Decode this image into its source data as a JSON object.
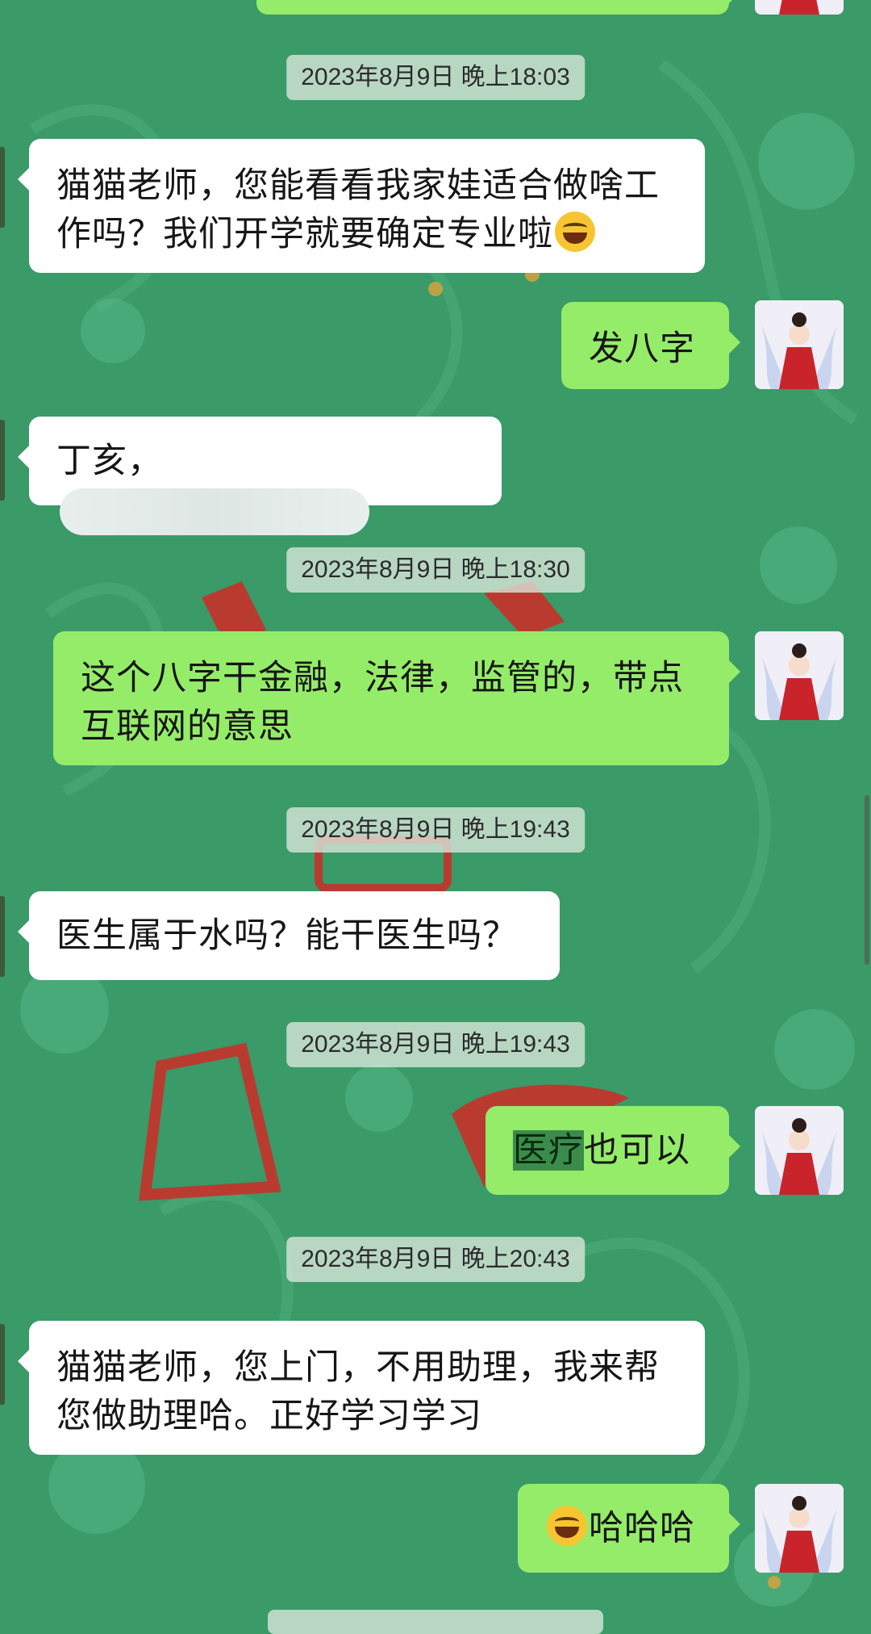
{
  "messages": [
    {
      "type": "timestamp",
      "text": "2023年8月9日 晚上18:03"
    },
    {
      "type": "incoming",
      "text": "猫猫老师，您能看看我家娃适合做啥工作吗？我们开学就要确定专业啦",
      "emoji": "grinning-squinting-face"
    },
    {
      "type": "outgoing",
      "text": "发八字"
    },
    {
      "type": "incoming",
      "text": "丁亥，",
      "redacted": true
    },
    {
      "type": "timestamp",
      "text": "2023年8月9日 晚上18:30"
    },
    {
      "type": "outgoing",
      "text": "这个八字干金融，法律，监管的，带点互联网的意思"
    },
    {
      "type": "timestamp",
      "text": "2023年8月9日 晚上19:43"
    },
    {
      "type": "incoming",
      "text": "医生属于水吗？能干医生吗？"
    },
    {
      "type": "timestamp",
      "text": "2023年8月9日 晚上19:43"
    },
    {
      "type": "outgoing",
      "highlight": "医疗",
      "text": "也可以"
    },
    {
      "type": "timestamp",
      "text": "2023年8月9日 晚上20:43"
    },
    {
      "type": "incoming",
      "text": "猫猫老师，您上门，不用助理，我来帮您做助理哈。正好学习学习"
    },
    {
      "type": "outgoing",
      "text": "哈哈哈",
      "emoji": "tears-of-joy-face"
    }
  ],
  "colors": {
    "background": "#3a9a68",
    "incoming_bubble": "#ffffff",
    "outgoing_bubble": "#95ec69",
    "timestamp_bg": "#dce8dc"
  }
}
